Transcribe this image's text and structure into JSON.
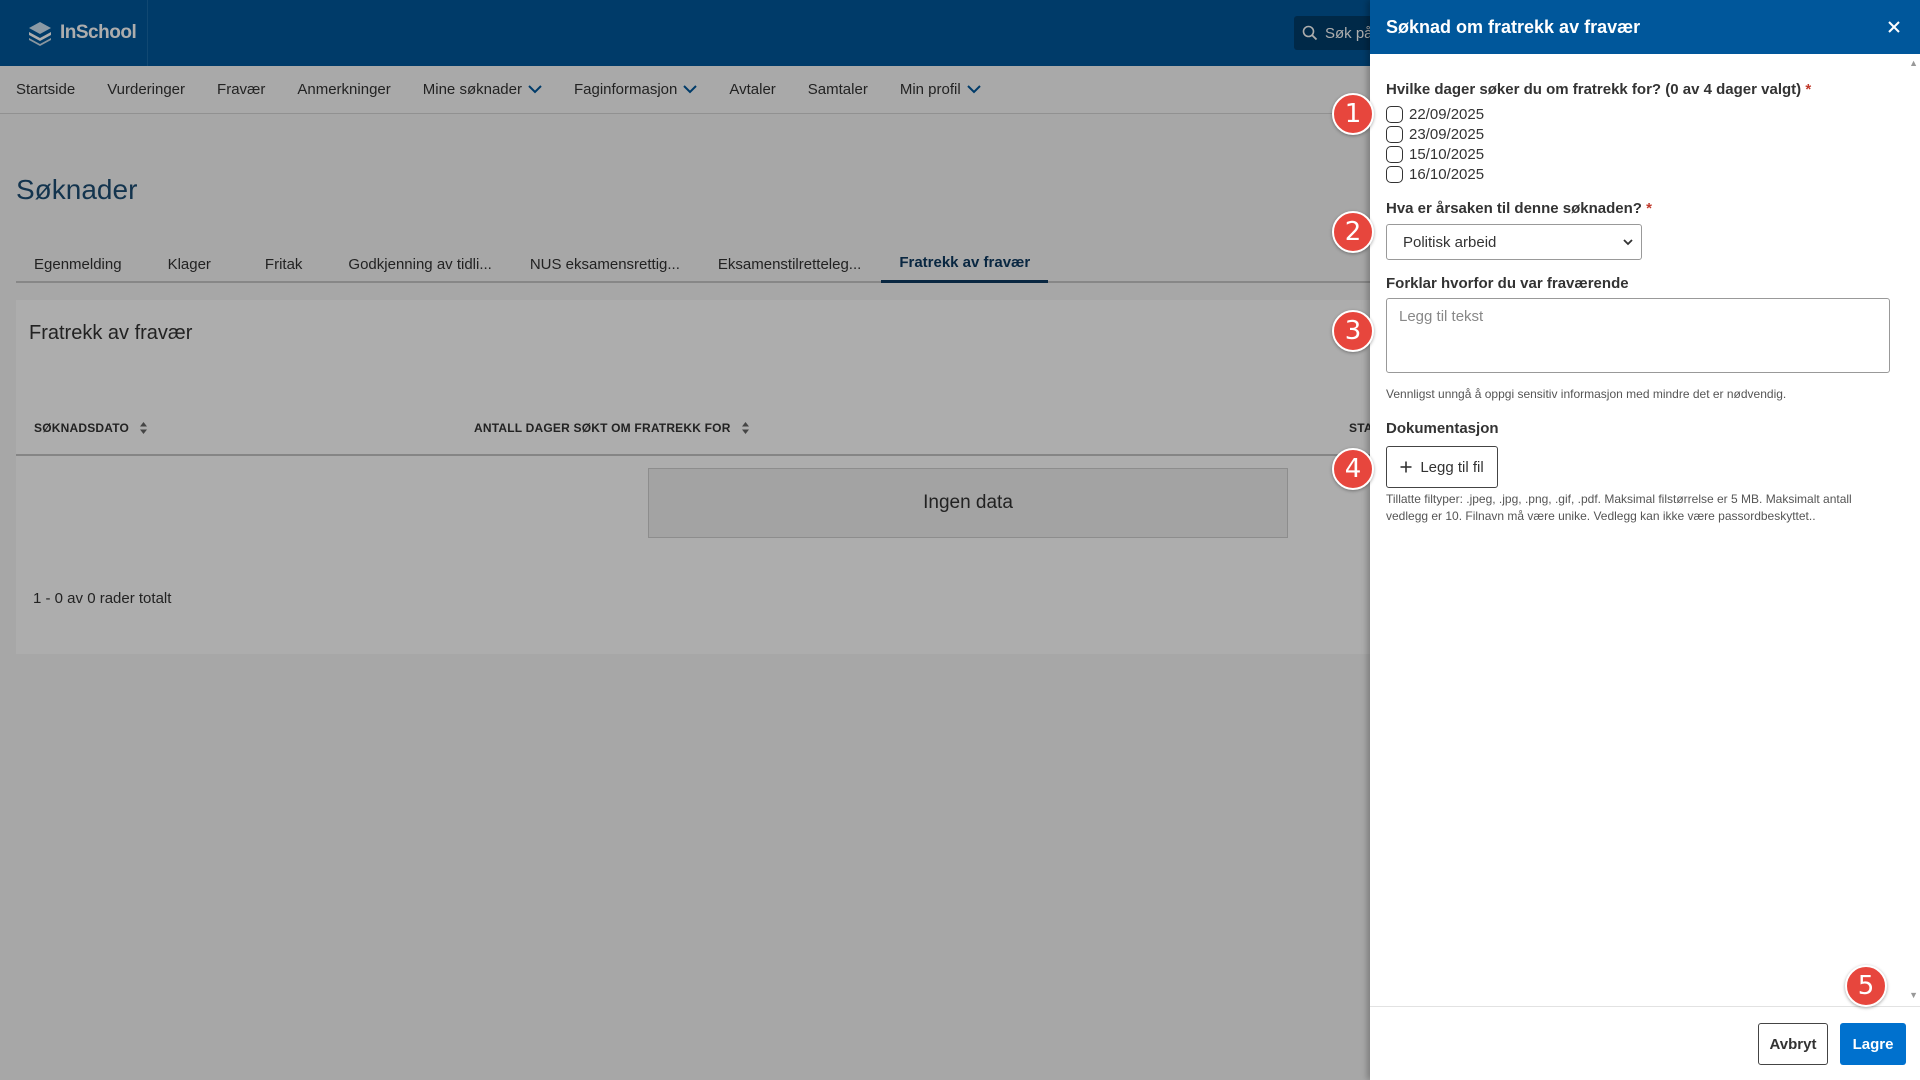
{
  "app": {
    "logo_text": "InSchool",
    "search_text": "Søk på"
  },
  "nav": {
    "items": [
      {
        "label": "Startside",
        "chevron": false
      },
      {
        "label": "Vurderinger",
        "chevron": false
      },
      {
        "label": "Fravær",
        "chevron": false
      },
      {
        "label": "Anmerkninger",
        "chevron": false
      },
      {
        "label": "Mine søknader",
        "chevron": true
      },
      {
        "label": "Faginformasjon",
        "chevron": true
      },
      {
        "label": "Avtaler",
        "chevron": false
      },
      {
        "label": "Samtaler",
        "chevron": false
      },
      {
        "label": "Min profil",
        "chevron": true
      }
    ]
  },
  "page": {
    "title": "Søknader",
    "tabs": [
      {
        "label": "Egenmelding"
      },
      {
        "label": "Klager"
      },
      {
        "label": "Fritak"
      },
      {
        "label": "Godkjenning av tidli..."
      },
      {
        "label": "NUS eksamensrettig..."
      },
      {
        "label": "Eksamenstilretteleg..."
      },
      {
        "label": "Fratrekk av fravær"
      }
    ],
    "active_tab": "Fratrekk av fravær",
    "card_title": "Fratrekk av fravær",
    "columns": [
      "SØKNADSDATO",
      "ANTALL DAGER SØKT OM FRATREKK FOR",
      "STA"
    ],
    "empty_text": "Ingen data",
    "row_count": "1 - 0 av 0 rader totalt"
  },
  "panel": {
    "title": "Søknad om fratrekk av fravær",
    "days_label": "Hvilke dager søker du om fratrekk for? (0 av 4 dager valgt)",
    "required_mark": "*",
    "days": [
      {
        "date": "22/09/2025",
        "checked": false
      },
      {
        "date": "23/09/2025",
        "checked": false
      },
      {
        "date": "15/10/2025",
        "checked": false
      },
      {
        "date": "16/10/2025",
        "checked": false
      }
    ],
    "reason_label": "Hva er årsaken til denne søknaden?",
    "reason_value": "Politisk arbeid",
    "explain_label": "Forklar hvorfor du var fraværende",
    "explain_placeholder": "Legg til tekst",
    "explain_help": "Vennligst unngå å oppgi sensitiv informasjon med mindre det er nødvendig.",
    "doc_label": "Dokumentasjon",
    "add_file_label": "Legg til fil",
    "file_help": "Tillatte filtyper: .jpeg, .jpg, .png, .gif, .pdf. Maksimal filstørrelse er 5 MB. Maksimalt antall vedlegg er 10. Filnavn må være unike. Vedlegg kan ikke være passordbeskyttet..",
    "cancel_label": "Avbryt",
    "save_label": "Lagre"
  },
  "markers": [
    "1",
    "2",
    "3",
    "4",
    "5"
  ],
  "colors": {
    "brand": "#00579b",
    "primary_button": "#0071ce",
    "marker": "#e7463d",
    "required": "#c0392b"
  }
}
